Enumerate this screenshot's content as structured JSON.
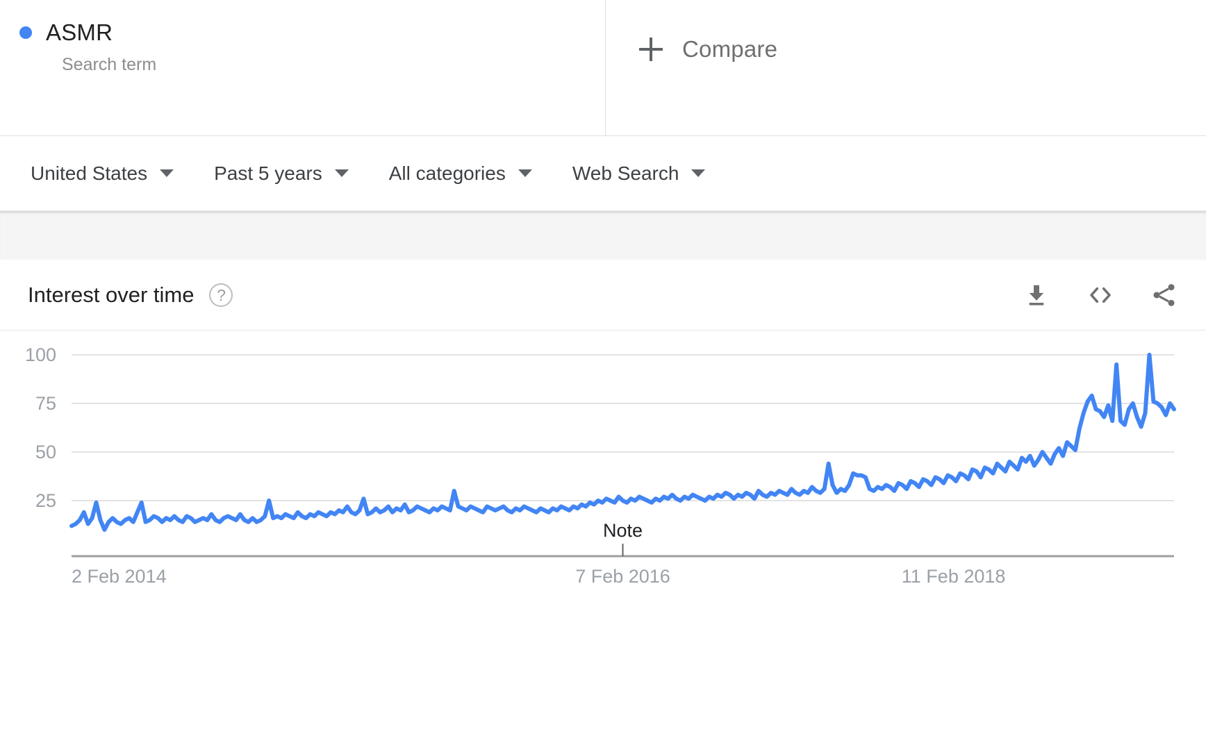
{
  "term": {
    "name": "ASMR",
    "subtitle": "Search term",
    "dot_color": "#4285f4"
  },
  "compare": {
    "label": "Compare",
    "icon": "plus-icon"
  },
  "filters": [
    {
      "label": "United States",
      "name": "region"
    },
    {
      "label": "Past 5 years",
      "name": "time-range"
    },
    {
      "label": "All categories",
      "name": "category"
    },
    {
      "label": "Web Search",
      "name": "search-type"
    }
  ],
  "card": {
    "title": "Interest over time",
    "help_glyph": "?",
    "actions": [
      {
        "name": "download-icon",
        "label": "Download"
      },
      {
        "name": "embed-icon",
        "label": "Embed"
      },
      {
        "name": "share-icon",
        "label": "Share"
      }
    ]
  },
  "chart_data": {
    "type": "line",
    "title": "Interest over time",
    "xlabel": "",
    "ylabel": "",
    "ylim": [
      0,
      100
    ],
    "y_ticks": [
      25,
      50,
      75,
      100
    ],
    "grid": true,
    "legend": "none",
    "line_color": "#4285f4",
    "x_tick_labels": [
      "2 Feb 2014",
      "7 Feb 2016",
      "11 Feb 2018"
    ],
    "x_tick_positions": [
      0,
      0.5,
      0.8
    ],
    "annotations": [
      {
        "label": "Note",
        "x": 0.5
      }
    ],
    "series": [
      {
        "name": "ASMR",
        "values": [
          12,
          13,
          15,
          19,
          13,
          16,
          24,
          15,
          10,
          14,
          16,
          14,
          13,
          15,
          16,
          14,
          19,
          24,
          14,
          15,
          17,
          16,
          14,
          16,
          15,
          17,
          15,
          14,
          17,
          16,
          14,
          15,
          16,
          15,
          18,
          15,
          14,
          16,
          17,
          16,
          15,
          18,
          15,
          14,
          16,
          14,
          15,
          17,
          25,
          16,
          17,
          16,
          18,
          17,
          16,
          19,
          17,
          16,
          18,
          17,
          19,
          18,
          17,
          19,
          18,
          20,
          19,
          22,
          19,
          18,
          20,
          26,
          18,
          19,
          21,
          19,
          20,
          22,
          19,
          21,
          20,
          23,
          19,
          20,
          22,
          21,
          20,
          19,
          21,
          20,
          22,
          21,
          20,
          30,
          22,
          21,
          20,
          22,
          21,
          20,
          19,
          22,
          21,
          20,
          21,
          22,
          20,
          19,
          21,
          20,
          22,
          21,
          20,
          19,
          21,
          20,
          19,
          21,
          20,
          22,
          21,
          20,
          22,
          21,
          23,
          22,
          24,
          23,
          25,
          24,
          26,
          25,
          24,
          27,
          25,
          24,
          26,
          25,
          27,
          26,
          25,
          24,
          26,
          25,
          27,
          26,
          28,
          26,
          25,
          27,
          26,
          28,
          27,
          26,
          25,
          27,
          26,
          28,
          27,
          29,
          28,
          26,
          28,
          27,
          29,
          28,
          26,
          30,
          28,
          27,
          29,
          28,
          30,
          29,
          28,
          31,
          29,
          28,
          30,
          29,
          32,
          30,
          29,
          31,
          44,
          33,
          29,
          31,
          30,
          33,
          39,
          38,
          38,
          37,
          31,
          30,
          32,
          31,
          33,
          32,
          30,
          34,
          33,
          31,
          35,
          34,
          32,
          36,
          35,
          33,
          37,
          36,
          34,
          38,
          37,
          35,
          39,
          38,
          36,
          41,
          40,
          37,
          42,
          41,
          39,
          44,
          42,
          40,
          45,
          43,
          41,
          47,
          45,
          48,
          43,
          46,
          50,
          47,
          44,
          49,
          52,
          48,
          55,
          53,
          51,
          62,
          70,
          76,
          79,
          72,
          71,
          68,
          74,
          66,
          95,
          66,
          64,
          72,
          75,
          68,
          63,
          70,
          100,
          76,
          75,
          73,
          69,
          75,
          72
        ]
      }
    ]
  }
}
